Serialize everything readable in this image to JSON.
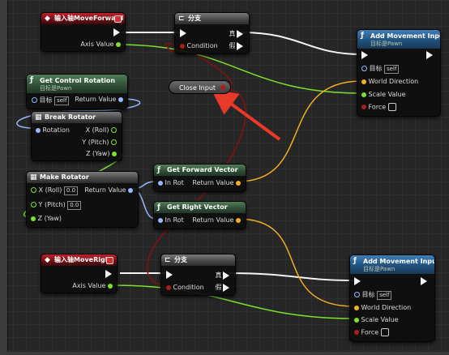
{
  "nodes": {
    "move_forward": {
      "title": "输入轴MoveForward",
      "axis_value": "Axis Value"
    },
    "branch_top": {
      "title": "分支",
      "condition": "Condition",
      "true_label": "真",
      "false_label": "假"
    },
    "add_movement_top": {
      "title": "Add Movement Input",
      "subtitle": "目标是Pawn",
      "target": "目标",
      "target_value": "self",
      "world_direction": "World Direction",
      "scale_value": "Scale Value",
      "force": "Force"
    },
    "get_control_rotation": {
      "title": "Get Control Rotation",
      "subtitle": "目标是Pawn",
      "target": "目标",
      "target_value": "self",
      "return_value": "Return Value"
    },
    "close_input": {
      "label": "Close Input"
    },
    "break_rotator": {
      "title": "Break Rotator",
      "rotation": "Rotation",
      "x_roll": "X (Roll)",
      "y_pitch": "Y (Pitch)",
      "z_yaw": "Z (Yaw)"
    },
    "make_rotator": {
      "title": "Make Rotator",
      "x_roll": "X (Roll)",
      "x_value": "0.0",
      "y_pitch": "Y (Pitch)",
      "y_value": "0.0",
      "z_yaw": "Z (Yaw)",
      "return_value": "Return Value"
    },
    "get_forward_vector": {
      "title": "Get Forward Vector",
      "in_rot": "In Rot",
      "return_value": "Return Value"
    },
    "get_right_vector": {
      "title": "Get Right Vector",
      "in_rot": "In Rot",
      "return_value": "Return Value"
    },
    "move_right": {
      "title": "输入轴MoveRight",
      "axis_value": "Axis Value"
    },
    "branch_bottom": {
      "title": "分支",
      "condition": "Condition",
      "true_label": "真",
      "false_label": "假"
    },
    "add_movement_bottom": {
      "title": "Add Movement Input",
      "subtitle": "目标是Pawn",
      "target": "目标",
      "target_value": "self",
      "world_direction": "World Direction",
      "scale_value": "Scale Value",
      "force": "Force"
    }
  },
  "colors": {
    "exec_wire": "#f5f5f5",
    "float_wire": "#7ce22d",
    "vector_wire": "#f2b01f",
    "rotator_wire": "#9bb8ff",
    "bool_wire": "#8a1010",
    "annotation_arrow": "#e8392b"
  },
  "icons": {
    "event": "diamond-event-icon",
    "branch": "branch-icon",
    "function": "function-icon",
    "struct": "struct-icon"
  }
}
